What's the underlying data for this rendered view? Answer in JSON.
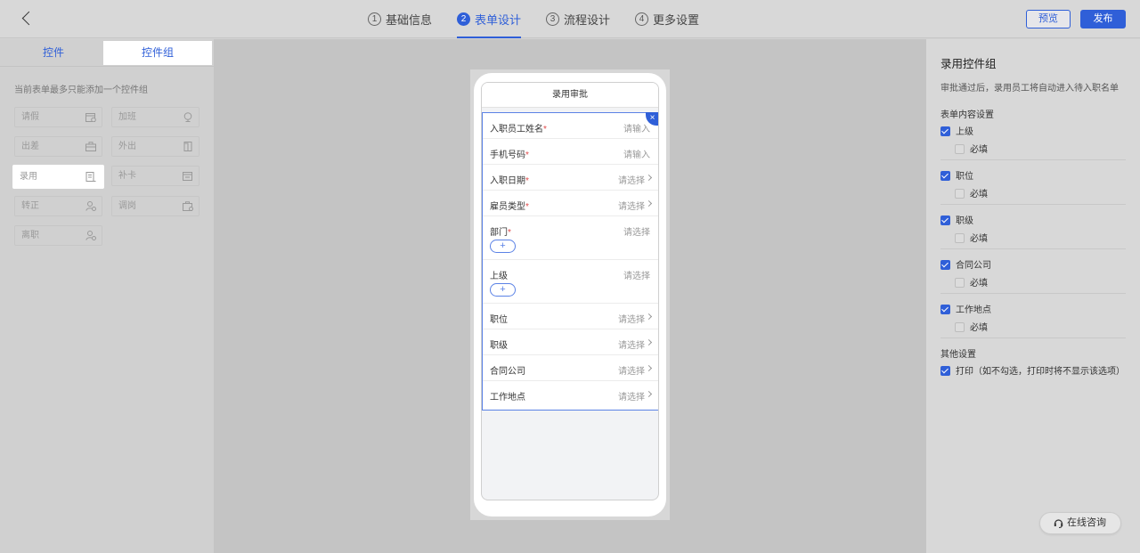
{
  "header": {
    "steps": [
      {
        "num": "1",
        "label": "基础信息"
      },
      {
        "num": "2",
        "label": "表单设计"
      },
      {
        "num": "3",
        "label": "流程设计"
      },
      {
        "num": "4",
        "label": "更多设置"
      }
    ],
    "active_step": 2,
    "preview_label": "预览",
    "publish_label": "发布"
  },
  "left": {
    "tabs": [
      "控件",
      "控件组"
    ],
    "active_tab": "控件组",
    "hint": "当前表单最多只能添加一个控件组",
    "controls": [
      {
        "label": "请假",
        "icon": "calendar-icon"
      },
      {
        "label": "加班",
        "icon": "lamp-icon"
      },
      {
        "label": "出差",
        "icon": "briefcase-icon"
      },
      {
        "label": "外出",
        "icon": "door-icon"
      },
      {
        "label": "录用",
        "icon": "document-icon"
      },
      {
        "label": "补卡",
        "icon": "calendar-icon"
      },
      {
        "label": "转正",
        "icon": "user-icon"
      },
      {
        "label": "调岗",
        "icon": "transfer-icon"
      },
      {
        "label": "离职",
        "icon": "user-icon"
      }
    ],
    "selected_control": "录用"
  },
  "canvas": {
    "form_title": "录用审批",
    "fields": [
      {
        "label": "入职员工姓名",
        "required": "*",
        "placeholder": "请输入"
      },
      {
        "label": "手机号码",
        "required": "*",
        "placeholder": "请输入"
      },
      {
        "label": "入职日期",
        "required": "*",
        "placeholder": "请选择"
      },
      {
        "label": "雇员类型",
        "required": "*",
        "placeholder": "请选择"
      },
      {
        "label": "部门",
        "required": "*",
        "placeholder": "请选择",
        "add": "+"
      },
      {
        "label": "上级",
        "required": "",
        "placeholder": "请选择",
        "add": "+"
      },
      {
        "label": "职位",
        "required": "",
        "placeholder": "请选择"
      },
      {
        "label": "职级",
        "required": "",
        "placeholder": "请选择"
      },
      {
        "label": "合同公司",
        "required": "",
        "placeholder": "请选择"
      },
      {
        "label": "工作地点",
        "required": "",
        "placeholder": "请选择"
      }
    ]
  },
  "right": {
    "title": "录用控件组",
    "description": "审批通过后，录用员工将自动进入待入职名单",
    "content_section": "表单内容设置",
    "items": [
      {
        "label": "上级",
        "checked": true,
        "required_label": "必填",
        "required_checked": false
      },
      {
        "label": "职位",
        "checked": true,
        "required_label": "必填",
        "required_checked": false
      },
      {
        "label": "职级",
        "checked": true,
        "required_label": "必填",
        "required_checked": false
      },
      {
        "label": "合同公司",
        "checked": true,
        "required_label": "必填",
        "required_checked": false
      },
      {
        "label": "工作地点",
        "checked": true,
        "required_label": "必填",
        "required_checked": false
      }
    ],
    "other_section": "其他设置",
    "print_label": "打印（如不勾选，打印时将不显示该选项）",
    "print_checked": true
  },
  "consult": {
    "label": "在线咨询",
    "icon": "headset-icon"
  },
  "colors": {
    "accent": "#2f5fd8",
    "required": "#e04a4a"
  }
}
